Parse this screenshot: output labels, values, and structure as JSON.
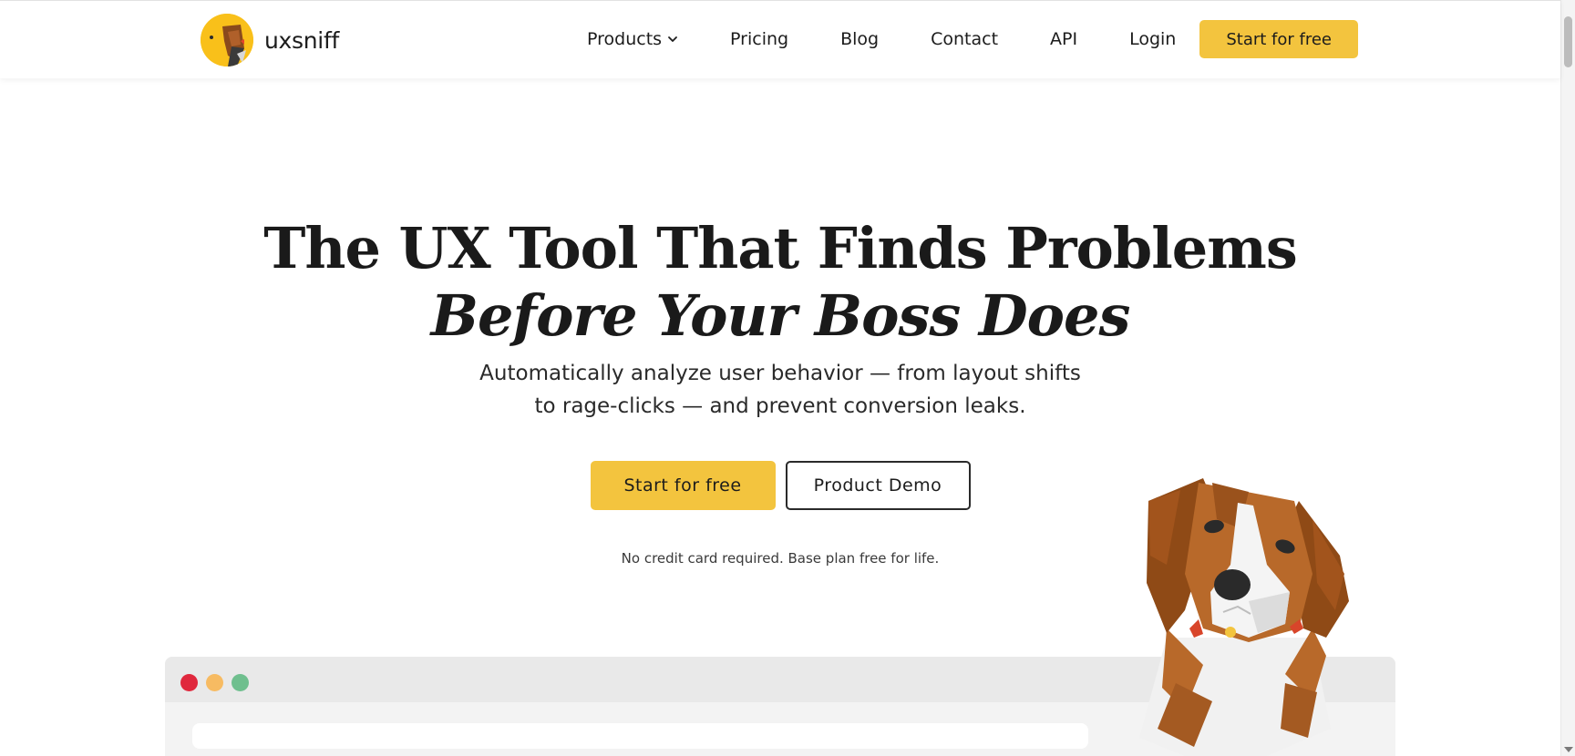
{
  "brand": {
    "name": "uxsniff",
    "color": "#f3c43e"
  },
  "nav": {
    "items": [
      {
        "label": "Products",
        "has_dropdown": true
      },
      {
        "label": "Pricing"
      },
      {
        "label": "Blog"
      },
      {
        "label": "Contact"
      },
      {
        "label": "API"
      },
      {
        "label": "Login"
      }
    ],
    "cta_label": "Start for free"
  },
  "hero": {
    "title_line1": "The UX Tool That Finds Problems",
    "title_line2": "Before Your Boss Does",
    "subtitle_line1": "Automatically analyze user behavior — from layout shifts",
    "subtitle_line2": "to rage-clicks — and prevent conversion leaks.",
    "primary_cta": "Start for free",
    "secondary_cta": "Product Demo",
    "fine_print": "No credit card required. Base plan free for life."
  },
  "icons": {
    "logo": "beagle-logo-icon",
    "dropdown": "chevron-down-icon",
    "illustration": "beagle-illustration",
    "window_controls": [
      "close-dot",
      "minimize-dot",
      "maximize-dot"
    ]
  },
  "colors": {
    "accent": "#f3c43e",
    "dot_red": "#e0283d",
    "dot_yellow": "#f7bb62",
    "dot_green": "#6fbf8e"
  }
}
